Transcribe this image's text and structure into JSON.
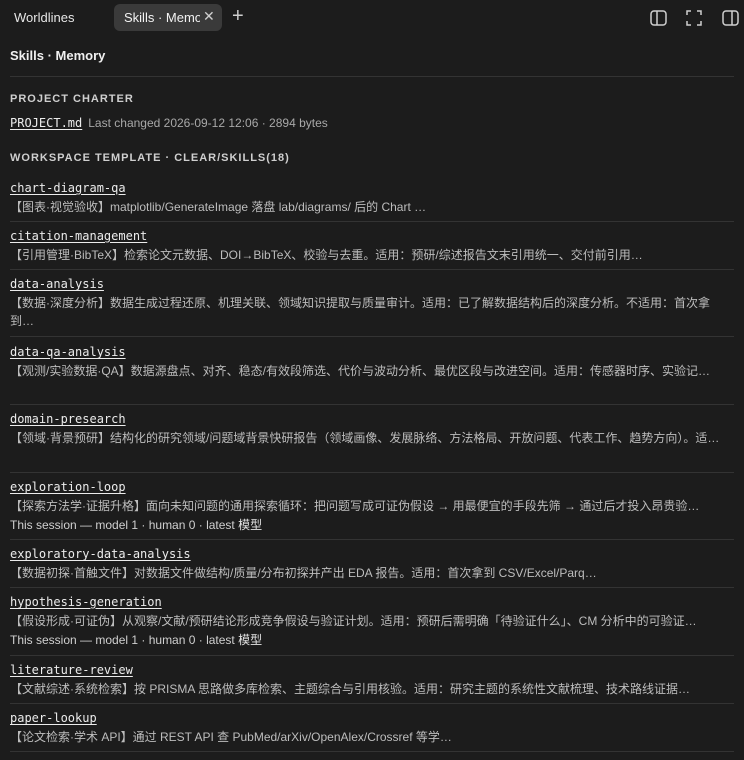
{
  "tabs": [
    {
      "label": "Worldlines"
    },
    {
      "label": "Skills · Memory"
    }
  ],
  "page": {
    "title": "Skills · Memory"
  },
  "charter": {
    "heading": "PROJECT CHARTER",
    "file": "PROJECT.md",
    "meta": "Last changed 2026-09-12 12:06 · 2894 bytes"
  },
  "template": {
    "heading": "WORKSPACE TEMPLATE · CLEAR/SKILLS(18)"
  },
  "skills": [
    {
      "name": "chart-diagram-qa",
      "desc": "【图表·视觉验收】matplotlib/GenerateImage 落盘 lab/diagrams/ 后的 Chart …"
    },
    {
      "name": "citation-management",
      "desc": "【引用管理·BibTeX】检索论文元数据、DOI→BibTeX、校验与去重。适用：预研/综述报告文末引用统一、交付前引用…"
    },
    {
      "name": "data-analysis",
      "desc": "【数据·深度分析】数据生成过程还原、机理关联、领域知识提取与质量审计。适用：已了解数据结构后的深度分析。不适用：首次拿到…"
    },
    {
      "name": "data-qa-analysis",
      "desc": "【观测/实验数据·QA】数据源盘点、对齐、稳态/有效段筛选、代价与波动分析、最优区段与改进空间。适用：传感器时序、实验记…"
    },
    {
      "name": "domain-presearch",
      "desc": "【领域·背景预研】结构化的研究领域/问题域背景快研报告（领域画像、发展脉络、方法格局、开放问题、代表工作、趋势方向）。适…"
    },
    {
      "name": "exploration-loop",
      "desc": "【探索方法学·证据升格】面向未知问题的通用探索循环：把问题写成可证伪假设 → 用最便宜的手段先筛 → 通过后才投入昂贵验…",
      "session": "This session — model 1 · human 0 · latest ",
      "session_model": "模型"
    },
    {
      "name": "exploratory-data-analysis",
      "desc": "【数据初探·首触文件】对数据文件做结构/质量/分布初探并产出 EDA 报告。适用：首次拿到 CSV/Excel/Parq…"
    },
    {
      "name": "hypothesis-generation",
      "desc": "【假设形成·可证伪】从观察/文献/预研结论形成竞争假设与验证计划。适用：预研后需明确「待验证什么」、CM 分析中的可验证…",
      "session": "This session — model 1 · human 0 · latest ",
      "session_model": "模型"
    },
    {
      "name": "literature-review",
      "desc": "【文献综述·系统检索】按 PRISMA 思路做多库检索、主题综合与引用核验。适用：研究主题的系统性文献梳理、技术路线证据…"
    },
    {
      "name": "paper-lookup",
      "desc": "【论文检索·学术 API】通过 REST API 查 PubMed/arXiv/OpenAlex/Crossref 等学…"
    }
  ]
}
